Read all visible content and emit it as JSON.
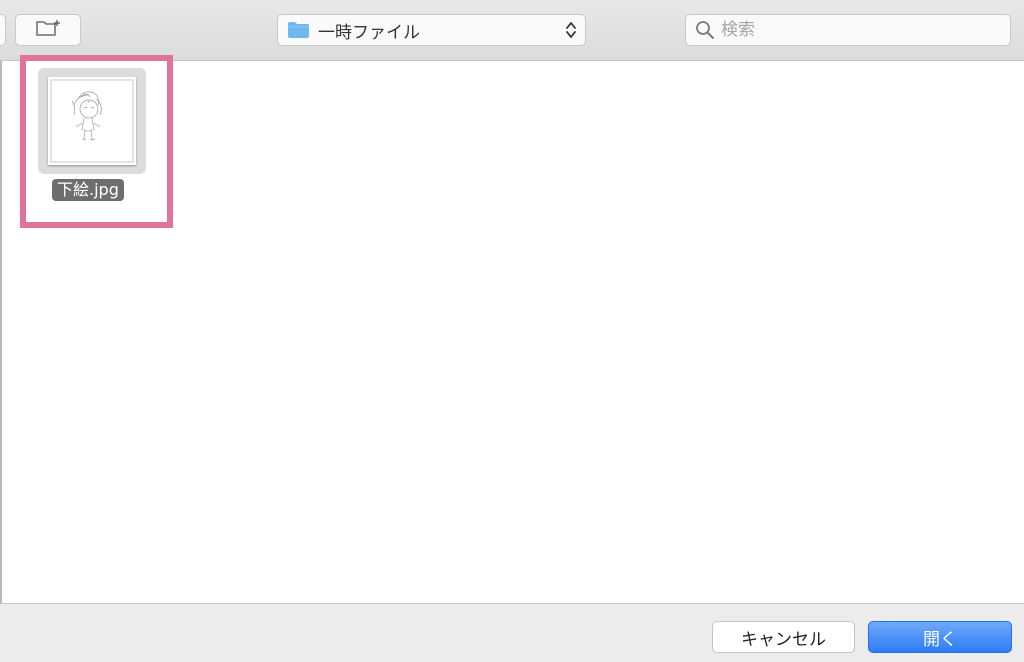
{
  "toolbar": {
    "location_label": "一時ファイル",
    "search_placeholder": "検索"
  },
  "files": [
    {
      "name": "下絵.jpg",
      "selected": true
    }
  ],
  "footer": {
    "cancel_label": "キャンセル",
    "open_label": "開く"
  },
  "colors": {
    "highlight": "#e07399",
    "primary_button": "#2f7cf6",
    "folder": "#6cb8ef",
    "selection_label": "#6e6e6e"
  },
  "icons": [
    "new-folder-icon",
    "folder-icon",
    "updown-chevron-icon",
    "search-icon"
  ]
}
